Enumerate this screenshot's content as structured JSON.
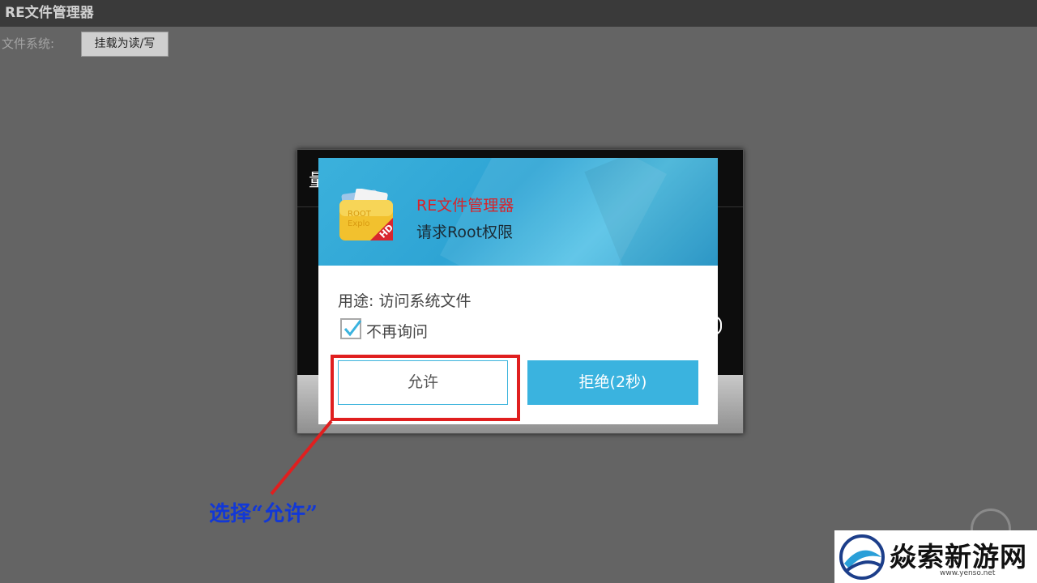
{
  "app": {
    "title": "RE文件管理器",
    "fs_label": "文件系统:",
    "mount_button": "挂载为读/写"
  },
  "underlying_dialog": {
    "title_fragment": "量"
  },
  "su_prompt": {
    "icon_text": "ROOT Explorer HD",
    "app_name": "RE文件管理器",
    "request": "请求Root权限",
    "purpose": "用途: 访问系统文件",
    "remember_label": "不再询问",
    "remember_checked": true,
    "allow_button": "允许",
    "deny_button": "拒绝(2秒)"
  },
  "annotation": {
    "caption": "选择“允许”",
    "highlight_color": "#e01f1f",
    "caption_color": "#1238d6"
  },
  "watermark": {
    "text": "焱索新游网",
    "url": "www.yenso.net"
  },
  "colors": {
    "header_blue": "#3bb1dc",
    "deny_blue": "#3ab3df",
    "app_name_red": "#d8232a"
  }
}
